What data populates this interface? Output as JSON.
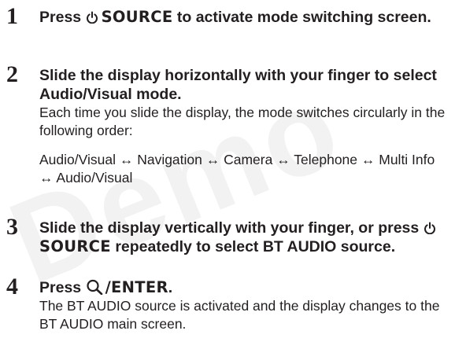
{
  "watermark": "Demo",
  "steps": [
    {
      "number": "1",
      "heading_before": "Press",
      "key": "SOURCE",
      "heading_after": "to activate mode switching screen."
    },
    {
      "number": "2",
      "heading": "Slide the display horizontally with your finger to select Audio/Visual mode.",
      "desc": "Each time you slide the display, the mode switches circularly in the following order:",
      "order": "Audio/Visual ↔ Navigation ↔ Camera ↔ Telephone ↔ Multi Info ↔ Audio/Visual"
    },
    {
      "number": "3",
      "heading_before": "Slide the display vertically with your finger, or press",
      "key": "SOURCE",
      "heading_after": "repeatedly to select BT AUDIO source."
    },
    {
      "number": "4",
      "heading_before": "Press",
      "key": "/ENTER",
      "heading_after": ".",
      "desc": "The BT AUDIO source is activated and the display changes to the BT AUDIO main screen."
    }
  ],
  "icons": {
    "power": "power-icon",
    "search": "search-icon"
  }
}
